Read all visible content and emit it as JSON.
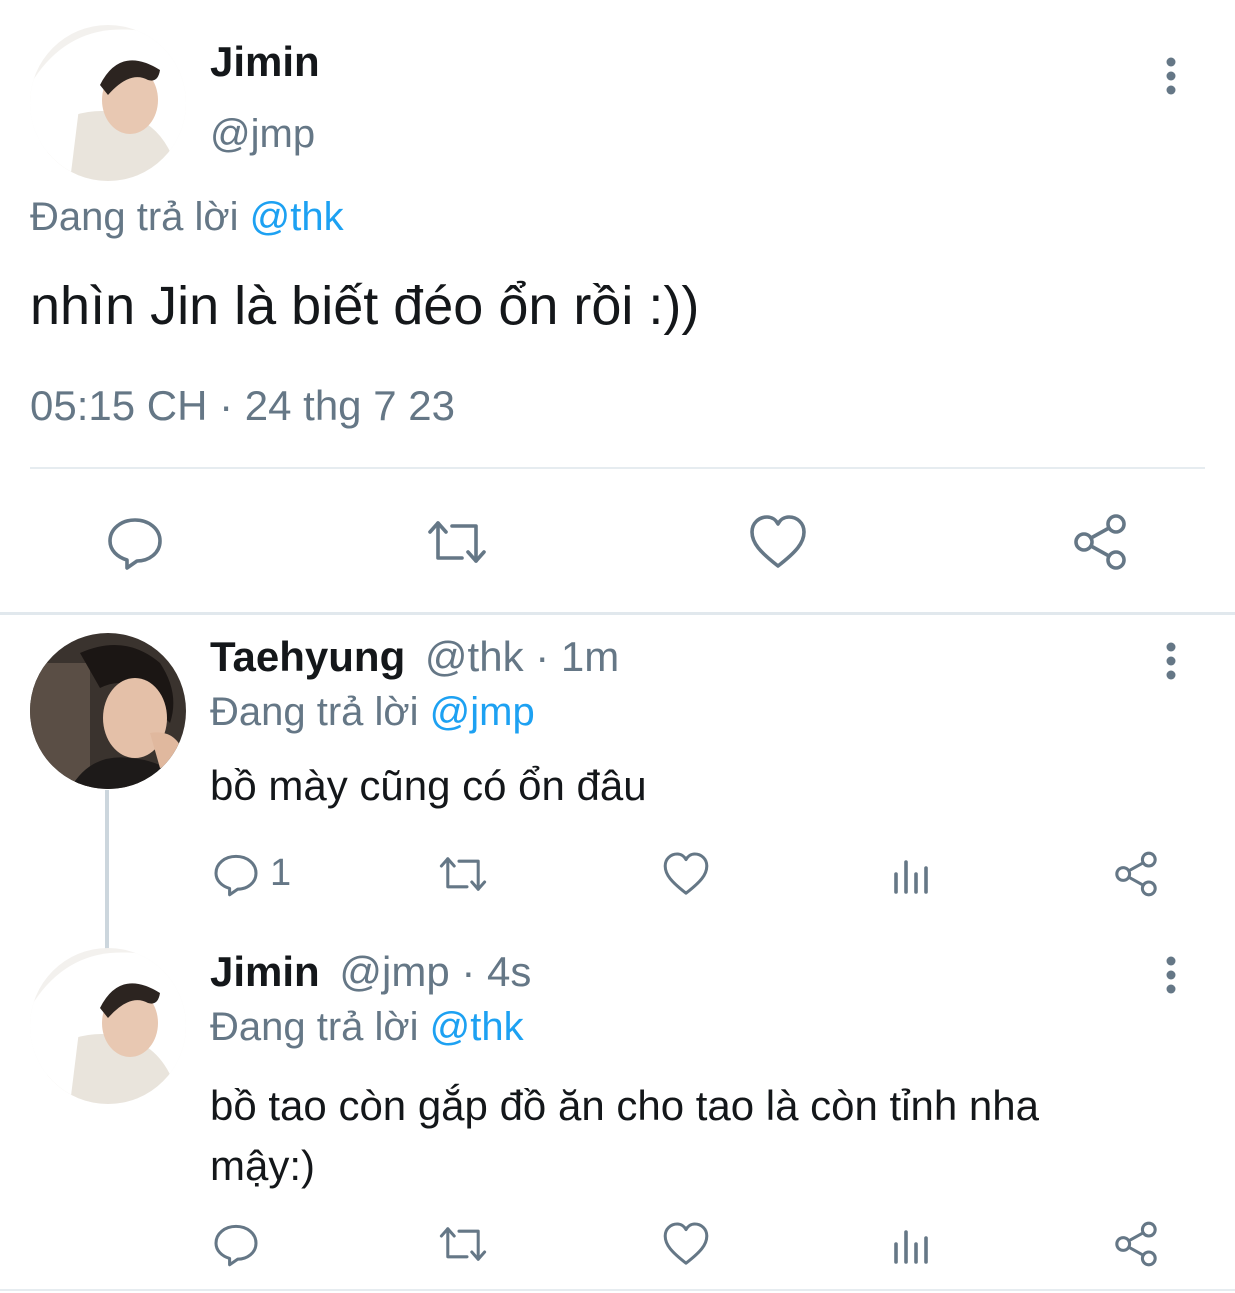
{
  "main_tweet": {
    "display_name": "Jimin",
    "handle": "@jmp",
    "reply_prefix": "Đang trả lời",
    "reply_to": "@thk",
    "text": "nhìn Jin là biết đéo ổn rồi :))",
    "timestamp": "05:15 CH · 24 thg 7 23",
    "actions": [
      "reply-icon",
      "retweet-icon",
      "like-icon",
      "share-icon"
    ]
  },
  "replies": [
    {
      "display_name": "Taehyung",
      "meta": "@thk · 1m",
      "reply_prefix": "Đang trả lời",
      "reply_to": "@jmp",
      "text": "bồ mày cũng có ổn đâu",
      "reply_count": "1",
      "actions": [
        "reply-icon",
        "retweet-icon",
        "like-icon",
        "analytics-icon",
        "share-icon"
      ]
    },
    {
      "display_name": "Jimin",
      "meta": "@jmp · 4s",
      "reply_prefix": "Đang trả lời",
      "reply_to": "@thk",
      "text_line1": "bồ tao còn gắp đồ ăn cho tao là còn tỉnh nha",
      "text_line2": "mậy:)",
      "reply_count": "",
      "actions": [
        "reply-icon",
        "retweet-icon",
        "like-icon",
        "analytics-icon",
        "share-icon"
      ]
    }
  ],
  "colors": {
    "link": "#1da1f2",
    "muted": "#657786",
    "text": "#14171a",
    "divider": "#e6ecf0"
  }
}
